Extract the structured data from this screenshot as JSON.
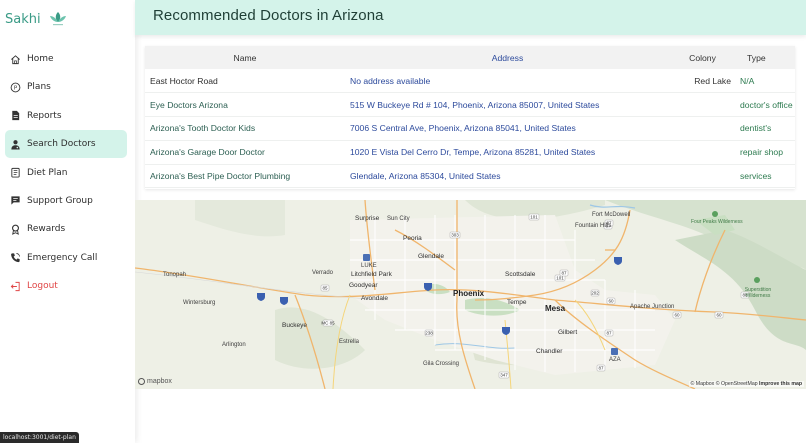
{
  "brand": {
    "name": "Sakhi"
  },
  "sidebar": {
    "items": [
      {
        "label": "Home",
        "icon": "home-icon"
      },
      {
        "label": "Plans",
        "icon": "plans-icon"
      },
      {
        "label": "Reports",
        "icon": "reports-icon"
      },
      {
        "label": "Search Doctors",
        "icon": "doctor-icon",
        "active": true
      },
      {
        "label": "Diet Plan",
        "icon": "diet-icon"
      },
      {
        "label": "Support Group",
        "icon": "chat-icon"
      },
      {
        "label": "Rewards",
        "icon": "rewards-icon"
      },
      {
        "label": "Emergency Call",
        "icon": "phone-icon"
      },
      {
        "label": "Logout",
        "icon": "logout-icon"
      }
    ]
  },
  "header": {
    "title": "Recommended Doctors in Arizona"
  },
  "table": {
    "columns": {
      "name": "Name",
      "address": "Address",
      "colony": "Colony",
      "type": "Type"
    },
    "rows": [
      {
        "name": "East Hoctor Road",
        "address": "No address available",
        "colony": "Red Lake",
        "type": "N/A"
      },
      {
        "name": "Eye Doctors Arizona",
        "address": "515 W Buckeye Rd # 104, Phoenix, Arizona 85007, United States",
        "colony": "",
        "type": "doctor's office"
      },
      {
        "name": "Arizona's Tooth Doctor Kids",
        "address": "7006 S Central Ave, Phoenix, Arizona 85041, United States",
        "colony": "",
        "type": "dentist's"
      },
      {
        "name": "Arizona's Garage Door Doctor",
        "address": "1020 E Vista Del Cerro Dr, Tempe, Arizona 85281, United States",
        "colony": "",
        "type": "repair shop"
      },
      {
        "name": "Arizona's Best Pipe Doctor Plumbing",
        "address": "Glendale, Arizona 85304, United States",
        "colony": "",
        "type": "services"
      }
    ]
  },
  "map": {
    "places": {
      "phoenix": "Phoenix",
      "mesa": "Mesa",
      "glendale": "Glendale",
      "peoria": "Peoria",
      "scottsdale": "Scottsdale",
      "tempe": "Tempe",
      "gilbert": "Gilbert",
      "chandler": "Chandler",
      "surprise": "Surprise",
      "sun_city": "Sun City",
      "litchfield_park": "Litchfield Park",
      "goodyear": "Goodyear",
      "avondale": "Avondale",
      "buckeye": "Buckeye",
      "estrella": "Estrella",
      "arlington": "Arlington",
      "tonopah": "Tonopah",
      "wintersburg": "Wintersburg",
      "verrado": "Verrado",
      "fort_mcdowell": "Fort McDowell",
      "fountain_hills": "Fountain Hills",
      "apache_junction": "Apache Junction",
      "gila_crossing": "Gila Crossing",
      "luke": "LUKE",
      "aza": "AZA",
      "four_peaks": "Four Peaks Wilderness",
      "superstition": "Superstition Wilderness"
    },
    "attribution": {
      "mapbox": "© Mapbox",
      "osm": "© OpenStreetMap",
      "improve": "Improve this map"
    },
    "logo": "mapbox"
  },
  "status_url": "localhost:3001/diet-plan",
  "colors": {
    "accent": "#d4f3ea",
    "brand": "#3a9b86",
    "logout": "#e04545",
    "link": "#2c4a9c"
  }
}
